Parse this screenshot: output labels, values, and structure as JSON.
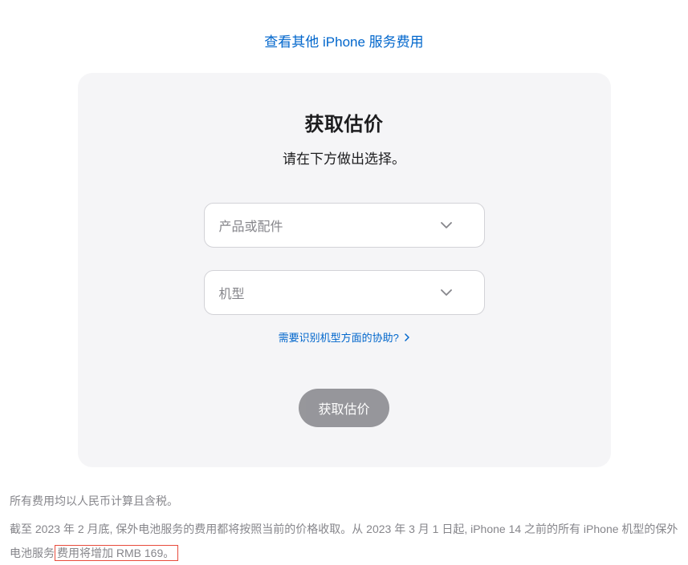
{
  "topLink": {
    "label": "查看其他 iPhone 服务费用"
  },
  "card": {
    "title": "获取估价",
    "subtitle": "请在下方做出选择。",
    "select1": {
      "placeholder": "产品或配件"
    },
    "select2": {
      "placeholder": "机型"
    },
    "helpLink": "需要识别机型方面的协助?",
    "button": "获取估价"
  },
  "footer": {
    "note1": "所有费用均以人民币计算且含税。",
    "note2Prefix": "截至 2023 年 2 月底, 保外电池服务的费用都将按照当前的价格收取。从 2023 年 3 月 1 日起, iPhone 14 之前的所有 iPhone 机型的保外电池服务",
    "note2Highlight": "费用将增加 RMB 169。"
  }
}
